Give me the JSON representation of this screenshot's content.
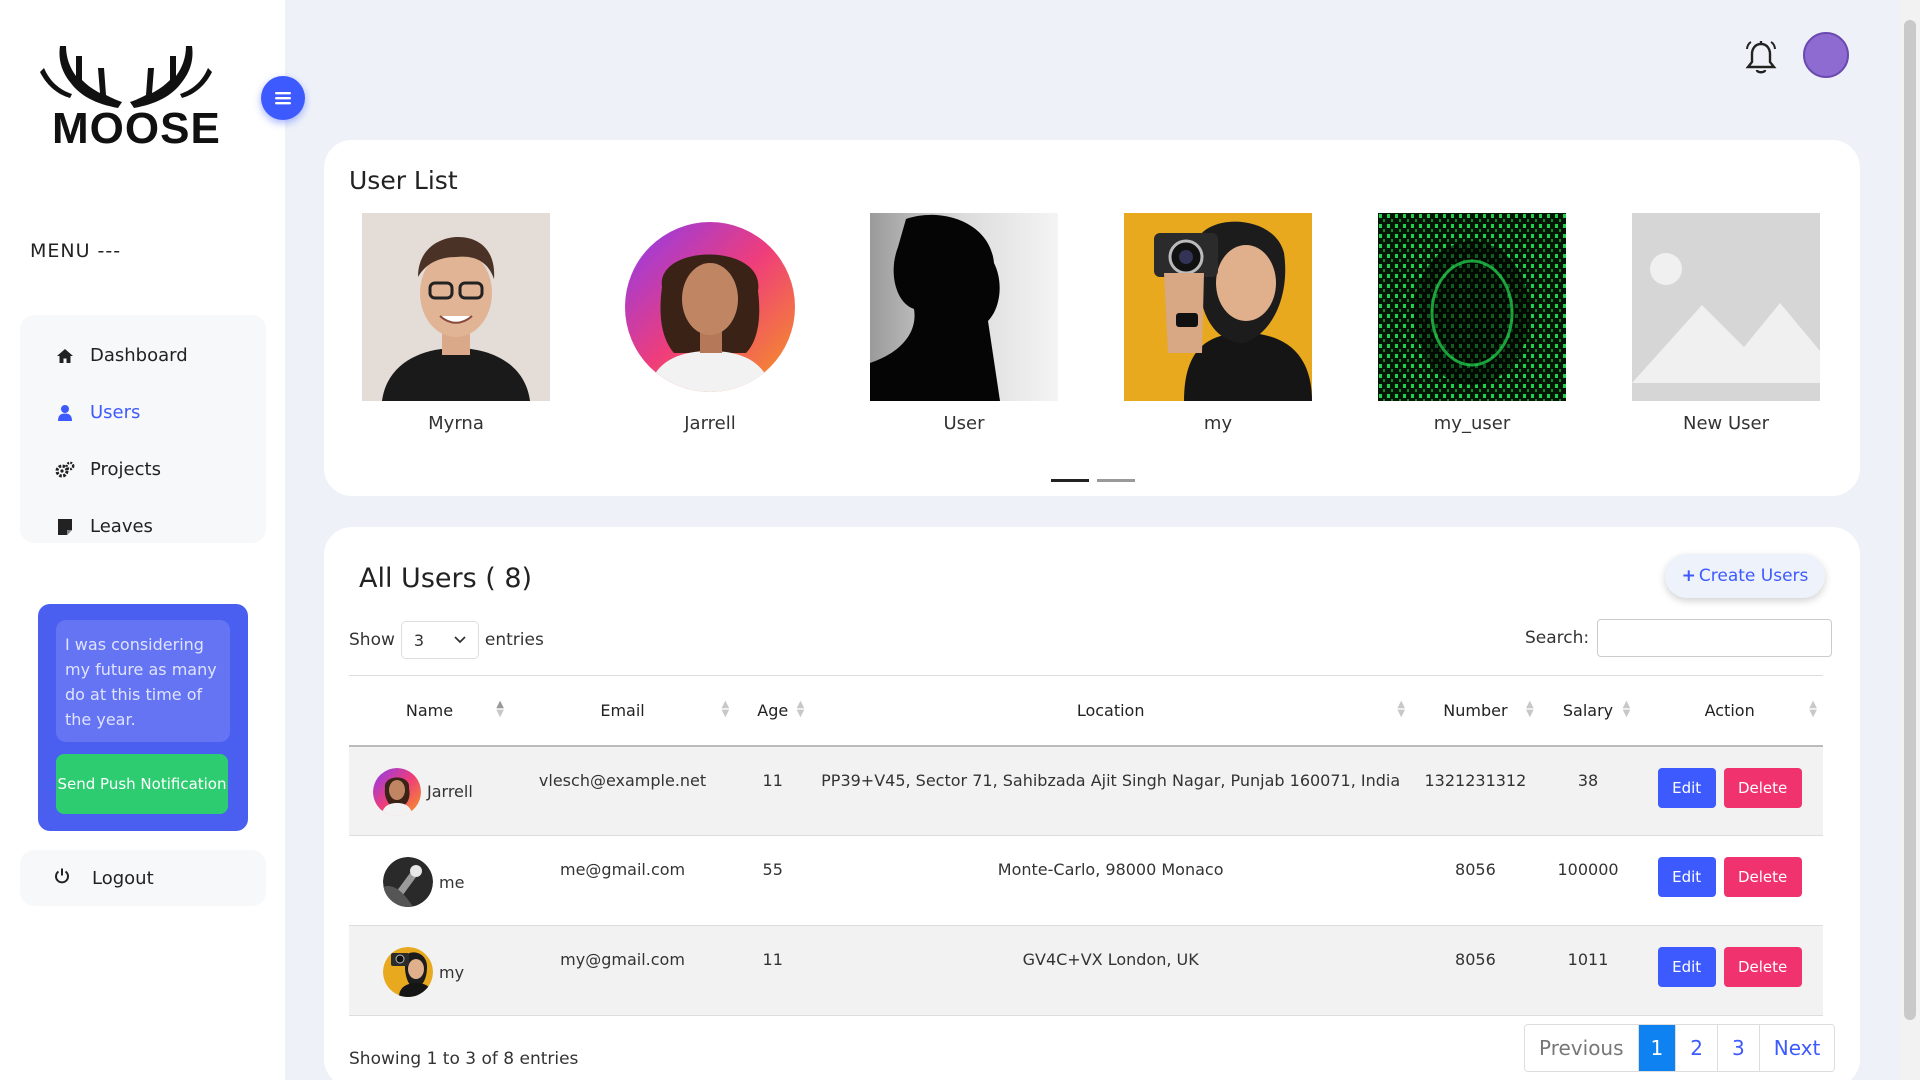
{
  "brand": {
    "logo_text": "MOOSE"
  },
  "sidebar": {
    "menu_label": "MENU ---",
    "items": [
      {
        "label": "Dashboard",
        "icon": "home-icon",
        "active": false
      },
      {
        "label": "Users",
        "icon": "user-icon",
        "active": true
      },
      {
        "label": "Projects",
        "icon": "gears-icon",
        "active": false
      },
      {
        "label": "Leaves",
        "icon": "note-icon",
        "active": false
      }
    ],
    "push_card": {
      "message": "I was considering my future as many do at this time of the year.",
      "button_label": "Send Push Notification"
    },
    "logout_label": "Logout"
  },
  "user_list": {
    "title": "User List",
    "users": [
      {
        "name": "Myrna"
      },
      {
        "name": "Jarrell"
      },
      {
        "name": "User"
      },
      {
        "name": "my"
      },
      {
        "name": "my_user"
      },
      {
        "name": "New User"
      }
    ],
    "carousel_pages": 2,
    "carousel_active": 1
  },
  "all_users": {
    "title": "All Users ( 8)",
    "create_label": "Create Users",
    "show_label": "Show",
    "entries_label": "entries",
    "page_size": "3",
    "search_label": "Search:",
    "columns": [
      "Name",
      "Email",
      "Age",
      "Location",
      "Number",
      "Salary",
      "Action"
    ],
    "rows": [
      {
        "name": "Jarrell",
        "email": "vlesch@example.net",
        "age": "11",
        "location": "PP39+V45, Sector 71, Sahibzada Ajit Singh Nagar, Punjab 160071, India",
        "number": "1321231312",
        "salary": "38"
      },
      {
        "name": "me",
        "email": "me@gmail.com",
        "age": "55",
        "location": "Monte-Carlo, 98000 Monaco",
        "number": "8056",
        "salary": "100000"
      },
      {
        "name": "my",
        "email": "my@gmail.com",
        "age": "11",
        "location": "GV4C+VX London, UK",
        "number": "8056",
        "salary": "1011"
      }
    ],
    "edit_label": "Edit",
    "delete_label": "Delete",
    "showing_text": "Showing 1 to 3 of 8 entries",
    "pagination": {
      "previous": "Previous",
      "pages": [
        "1",
        "2",
        "3"
      ],
      "next": "Next",
      "active_page": "1"
    }
  },
  "colors": {
    "accent": "#3d5afe",
    "danger": "#f0336e",
    "success": "#2ecc71",
    "background": "#eef2f8"
  }
}
